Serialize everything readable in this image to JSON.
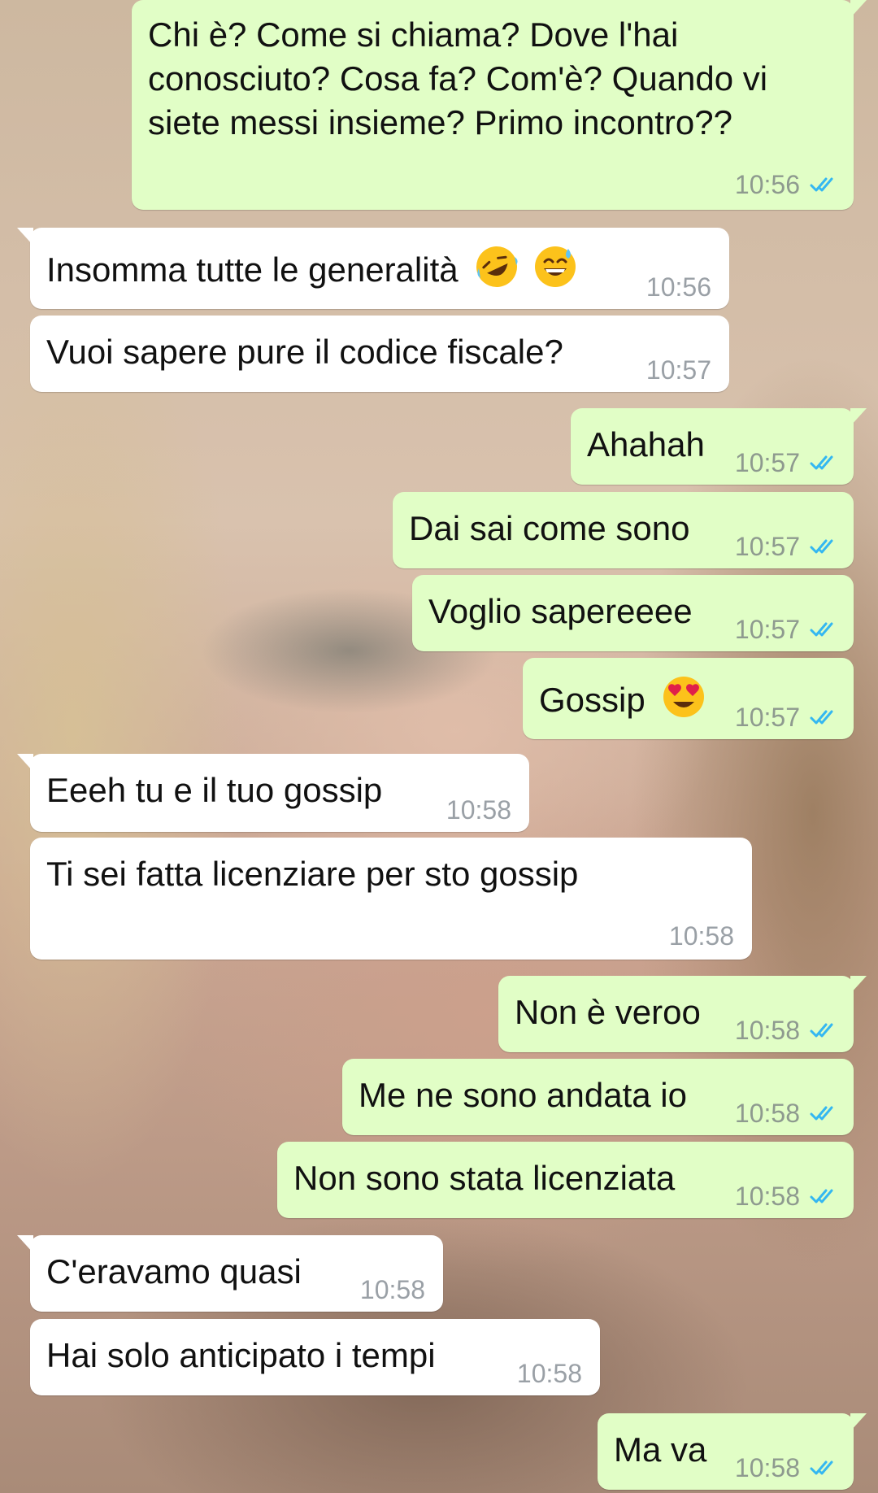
{
  "colors": {
    "outgoing_bubble": "#e1fec6",
    "incoming_bubble": "#ffffff",
    "read_ticks": "#34b7f1"
  },
  "messages": [
    {
      "direction": "out",
      "text": "Chi è? Come si chiama? Dove l'hai conosciuto? Cosa fa? Com'è? Quando vi siete messi insieme? Primo incontro??",
      "time": "10:56",
      "status": "read"
    },
    {
      "direction": "in",
      "text": "Insomma tutte le generalità",
      "emojis": [
        "rolling-on-floor-laughing-emoji",
        "grinning-sweat-emoji"
      ],
      "time": "10:56"
    },
    {
      "direction": "in",
      "text": "Vuoi sapere pure il codice fiscale?",
      "time": "10:57"
    },
    {
      "direction": "out",
      "text": "Ahahah",
      "time": "10:57",
      "status": "read"
    },
    {
      "direction": "out",
      "text": "Dai sai come sono",
      "time": "10:57",
      "status": "read"
    },
    {
      "direction": "out",
      "text": "Voglio sapereeee",
      "time": "10:57",
      "status": "read"
    },
    {
      "direction": "out",
      "text": "Gossip",
      "emojis": [
        "heart-eyes-emoji"
      ],
      "time": "10:57",
      "status": "read"
    },
    {
      "direction": "in",
      "text": "Eeeh tu e il tuo gossip",
      "time": "10:58"
    },
    {
      "direction": "in",
      "text": "Ti sei fatta licenziare per sto gossip",
      "time": "10:58"
    },
    {
      "direction": "out",
      "text": "Non è veroo",
      "time": "10:58",
      "status": "read"
    },
    {
      "direction": "out",
      "text": "Me ne sono andata io",
      "time": "10:58",
      "status": "read"
    },
    {
      "direction": "out",
      "text": "Non sono stata licenziata",
      "time": "10:58",
      "status": "read"
    },
    {
      "direction": "in",
      "text": "C'eravamo quasi",
      "time": "10:58"
    },
    {
      "direction": "in",
      "text": "Hai solo anticipato i tempi",
      "time": "10:58"
    },
    {
      "direction": "out",
      "text": "Ma va",
      "time": "10:58",
      "status": "read"
    }
  ]
}
